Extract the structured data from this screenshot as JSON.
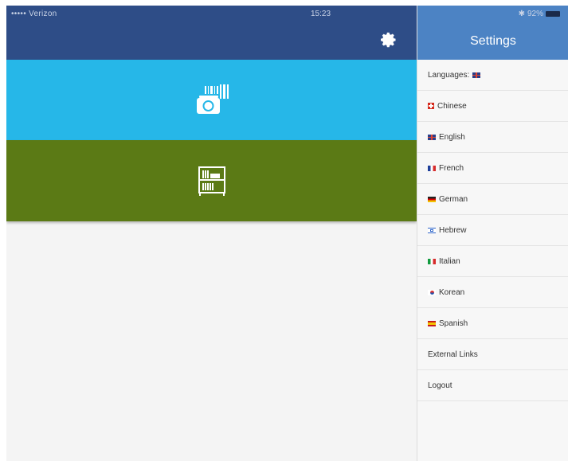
{
  "status_bar": {
    "carrier": "••••• Verizon",
    "time": "15:23",
    "battery": "92%"
  },
  "settings": {
    "title": "Settings",
    "languages_label": "Languages:",
    "languages": [
      {
        "label": "Chinese",
        "flag": "ch"
      },
      {
        "label": "English",
        "flag": "uk"
      },
      {
        "label": "French",
        "flag": "fr"
      },
      {
        "label": "German",
        "flag": "de"
      },
      {
        "label": "Hebrew",
        "flag": "il"
      },
      {
        "label": "Italian",
        "flag": "it"
      },
      {
        "label": "Korean",
        "flag": "kr"
      },
      {
        "label": "Spanish",
        "flag": "es"
      }
    ],
    "external_links": "External Links",
    "logout": "Logout"
  },
  "colors": {
    "navbar": "#2e4d87",
    "settings_header": "#4c83c4",
    "camera_tile": "#26b7e8",
    "library_tile": "#5b7a15"
  }
}
